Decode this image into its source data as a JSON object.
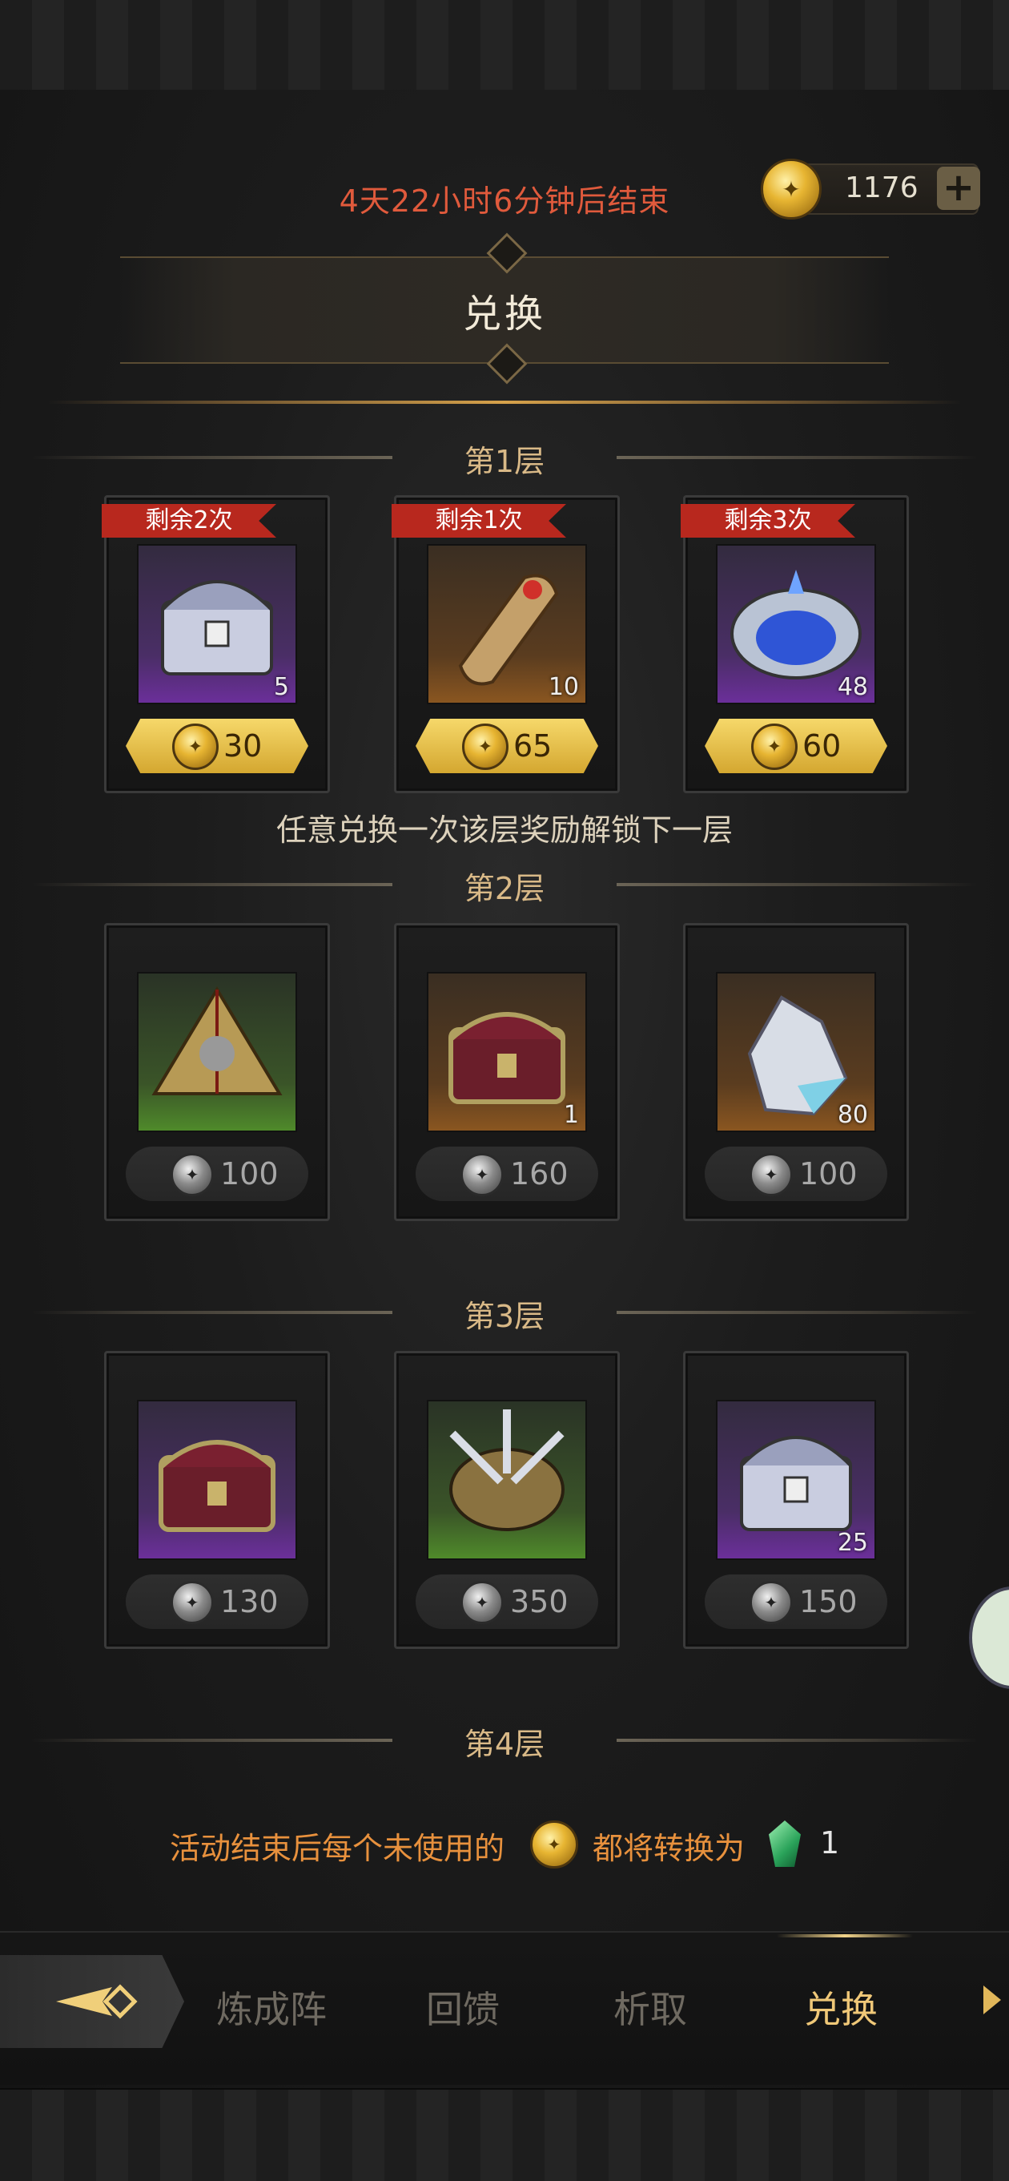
{
  "header": {
    "timer": "4天22小时6分钟后结束",
    "currency_amount": "1176",
    "plus_label": "+",
    "title": "兑换"
  },
  "tiers": [
    {
      "label": "第1层",
      "items": [
        {
          "remaining": "剩余2次",
          "count": "5",
          "price": "30",
          "bg": "purple",
          "icon": "silver-chest-icon"
        },
        {
          "remaining": "剩余1次",
          "count": "10",
          "price": "65",
          "bg": "orange",
          "icon": "scroll-icon"
        },
        {
          "remaining": "剩余3次",
          "count": "48",
          "price": "60",
          "bg": "purple",
          "icon": "blue-orb-chest-icon"
        }
      ]
    },
    {
      "label": "第2层",
      "items": [
        {
          "count": "",
          "price": "100",
          "bg": "green",
          "icon": "pyramid-relic-icon"
        },
        {
          "count": "1",
          "price": "160",
          "bg": "orange",
          "icon": "red-chest-icon"
        },
        {
          "count": "80",
          "price": "100",
          "bg": "orange",
          "icon": "crystal-ore-icon"
        }
      ]
    },
    {
      "label": "第3层",
      "items": [
        {
          "count": "",
          "price": "130",
          "bg": "purple",
          "icon": "red-chest-icon"
        },
        {
          "count": "",
          "price": "350",
          "bg": "green",
          "icon": "spiked-relic-icon"
        },
        {
          "count": "25",
          "price": "150",
          "bg": "purple",
          "icon": "silver-chest-icon"
        }
      ]
    },
    {
      "label": "第4层",
      "items": []
    }
  ],
  "unlock_note": "任意兑换一次该层奖励解锁下一层",
  "footer": {
    "text_before": "活动结束后每个未使用的",
    "text_after": "都将转换为",
    "quantity": "1"
  },
  "tabs": [
    {
      "label": "炼成阵",
      "active": false
    },
    {
      "label": "回馈",
      "active": false
    },
    {
      "label": "析取",
      "active": false
    },
    {
      "label": "兑换",
      "active": true
    }
  ],
  "colors": {
    "timer": "#e05a3c",
    "ribbon": "#b8281e",
    "gold_price": "#d4a730",
    "tier_label": "#d9b987",
    "active_tab": "#f0c878",
    "footer_text": "#e8913d"
  }
}
